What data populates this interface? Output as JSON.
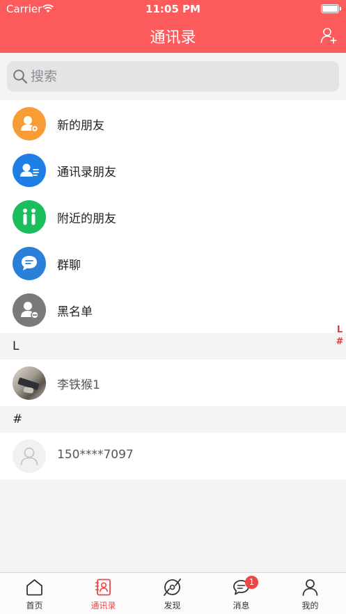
{
  "status_bar": {
    "carrier": "Carrier",
    "time": "11:05 PM"
  },
  "navbar": {
    "title": "通讯录",
    "add_icon": "add-contact-icon"
  },
  "search": {
    "placeholder": "搜索"
  },
  "menu_items": [
    {
      "label": "新的朋友",
      "icon": "new-friend-icon",
      "color": "#f89d36"
    },
    {
      "label": "通讯录朋友",
      "icon": "contact-card-icon",
      "color": "#1e7ee6"
    },
    {
      "label": "附近的朋友",
      "icon": "nearby-people-icon",
      "color": "#1bbd5c"
    },
    {
      "label": "群聊",
      "icon": "group-chat-icon",
      "color": "#2a7fd8"
    },
    {
      "label": "黑名单",
      "icon": "blocked-user-icon",
      "color": "#7a7a7a"
    }
  ],
  "sections": [
    {
      "header": "L",
      "contacts": [
        {
          "name": "李铁猴1",
          "avatar": "photo-avatar"
        }
      ]
    },
    {
      "header": "#",
      "contacts": [
        {
          "name": "150****7097",
          "avatar": "default-avatar"
        }
      ]
    }
  ],
  "index_bar": [
    "L",
    "#"
  ],
  "tabs": [
    {
      "label": "首页",
      "icon": "home-icon",
      "active": false
    },
    {
      "label": "通讯录",
      "icon": "contacts-icon",
      "active": true
    },
    {
      "label": "发现",
      "icon": "discover-icon",
      "active": false
    },
    {
      "label": "消息",
      "icon": "message-icon",
      "active": false,
      "badge": "1"
    },
    {
      "label": "我的",
      "icon": "profile-icon",
      "active": false
    }
  ],
  "colors": {
    "brand": "#fd5b5b",
    "active_tab": "#f04545"
  }
}
